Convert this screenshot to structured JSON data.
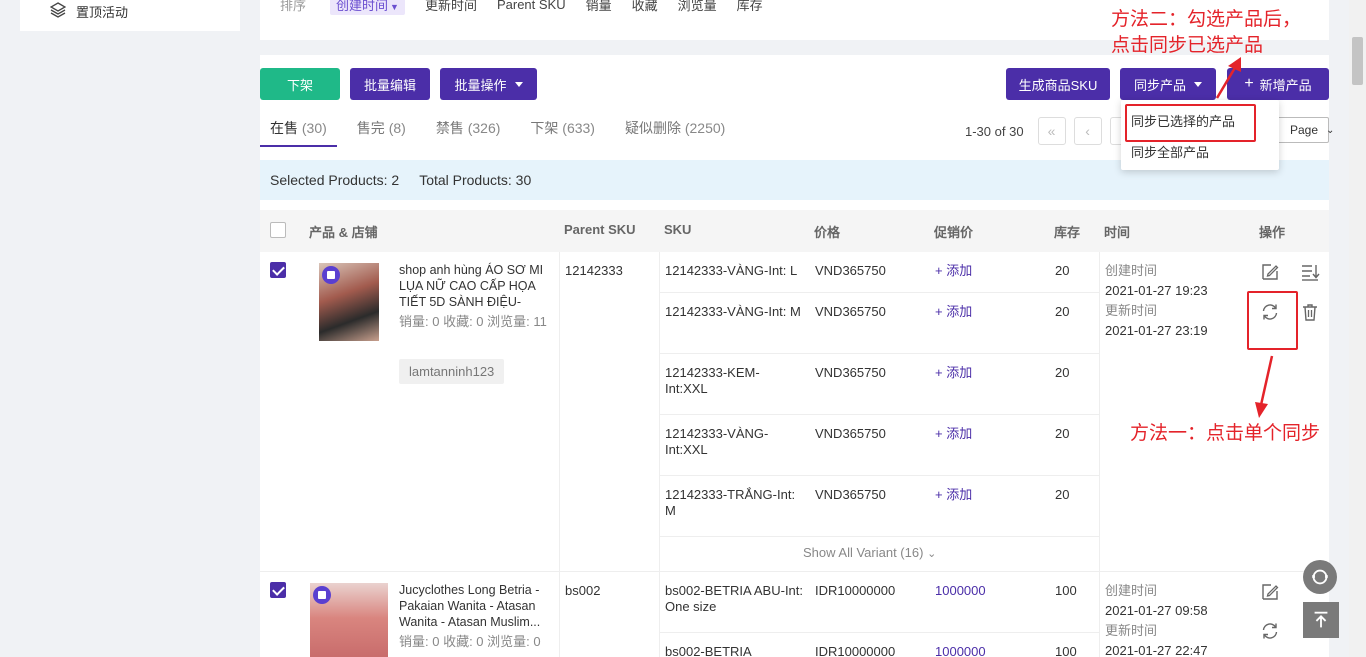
{
  "sidebar": {
    "item_label": "置顶活动"
  },
  "sort": {
    "label": "排序",
    "options": [
      "创建时间",
      "更新时间",
      "Parent SKU",
      "销量",
      "收藏",
      "浏览量",
      "库存"
    ]
  },
  "toolbar": {
    "delist": "下架",
    "bulk_edit": "批量编辑",
    "bulk_ops": "批量操作",
    "gen_sku": "生成商品SKU",
    "sync": "同步产品",
    "add": "新增产品"
  },
  "tabs": [
    {
      "label": "在售",
      "count": "(30)"
    },
    {
      "label": "售完",
      "count": "(8)"
    },
    {
      "label": "禁售",
      "count": "(326)"
    },
    {
      "label": "下架",
      "count": "(633)"
    },
    {
      "label": "疑似删除",
      "count": "(2250)"
    }
  ],
  "pager": {
    "range": "1-30 of 30",
    "per_page": "Page"
  },
  "info": {
    "selected": "Selected Products: 2",
    "total": "Total Products: 30"
  },
  "columns": {
    "product": "产品 & 店铺",
    "parent_sku": "Parent SKU",
    "sku": "SKU",
    "price": "价格",
    "promo": "促销价",
    "stock": "库存",
    "time": "时间",
    "ops": "操作"
  },
  "products": [
    {
      "title": "shop anh hùng ÁO SƠ MI LỤA NỮ CAO CẤP HỌA TIẾT 5D SÀNH ĐIỆU- SIÊ...",
      "stats": "销量: 0     收藏: 0     浏览量: 11",
      "shop": "lamtanninh123",
      "parent_sku": "12142333",
      "variants": [
        {
          "sku": "12142333-VÀNG-Int: L",
          "price": "VND365750",
          "promo": "+ 添加",
          "stock": "20"
        },
        {
          "sku": "12142333-VÀNG-Int: M",
          "price": "VND365750",
          "promo": "+ 添加",
          "stock": "20"
        },
        {
          "sku": "12142333-KEM-Int:XXL",
          "price": "VND365750",
          "promo": "+ 添加",
          "stock": "20"
        },
        {
          "sku": "12142333-VÀNG-Int:XXL",
          "price": "VND365750",
          "promo": "+ 添加",
          "stock": "20"
        },
        {
          "sku": "12142333-TRẮNG-Int: M",
          "price": "VND365750",
          "promo": "+ 添加",
          "stock": "20"
        }
      ],
      "show_all": "Show All Variant (16)",
      "created_label": "创建时间",
      "created": "2021-01-27 19:23",
      "updated_label": "更新时间",
      "updated": "2021-01-27 23:19"
    },
    {
      "title": "Jucyclothes Long Betria - Pakaian Wanita - Atasan Wanita - Atasan Muslim...",
      "stats": "销量: 0     收藏: 0     浏览量: 0",
      "parent_sku": "bs002",
      "variants": [
        {
          "sku": "bs002-BETRIA ABU-Int: One size",
          "price": "IDR10000000",
          "promo": "1000000",
          "stock": "100"
        },
        {
          "sku": "bs002-BETRIA",
          "price": "IDR10000000",
          "promo": "1000000",
          "stock": "100"
        }
      ],
      "created_label": "创建时间",
      "created": "2021-01-27 09:58",
      "updated_label": "更新时间",
      "updated": "2021-01-27 22:47"
    }
  ],
  "dropdown": {
    "sync_selected": "同步已选择的产品",
    "sync_all": "同步全部产品"
  },
  "annotations": {
    "method2_line1": "方法二：勾选产品后，",
    "method2_line2": "点击同步已选产品",
    "method1": "方法一：点击单个同步"
  },
  "colors": {
    "primary": "#4b2ea8",
    "green": "#1fb988",
    "annotation": "#e4232a"
  }
}
